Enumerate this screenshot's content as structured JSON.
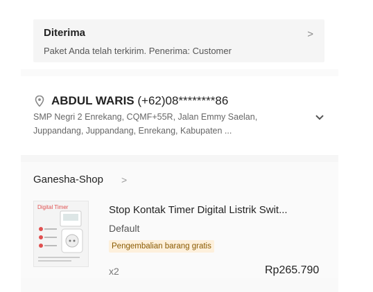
{
  "status": {
    "title": "Diterima",
    "description": "Paket Anda telah terkirim. Penerima: Customer",
    "chevron_icon": "chevron-right-icon"
  },
  "address": {
    "icon": "location-pin-icon",
    "name": "ABDUL WARIS",
    "phone": "(+62)08********86",
    "line1": "SMP Negri 2 Enrekang, CQMF+55R, Jalan Emmy Saelan,",
    "line2": "Juppandang, Juppandang, Enrekang, Kabupaten ...",
    "expand_icon": "chevron-down-icon"
  },
  "shop": {
    "name": "Ganesha-Shop",
    "chevron_icon": "chevron-right-icon"
  },
  "product": {
    "title": "Stop Kontak Timer Digital Listrik Swit...",
    "variant": "Default",
    "badge": "Pengembalian barang gratis",
    "quantity": "x2",
    "price": "Rp265.790",
    "thumb_label": "Digital Timer",
    "badge_color": "#fdf0dc",
    "badge_text_color": "#8a5a00"
  }
}
